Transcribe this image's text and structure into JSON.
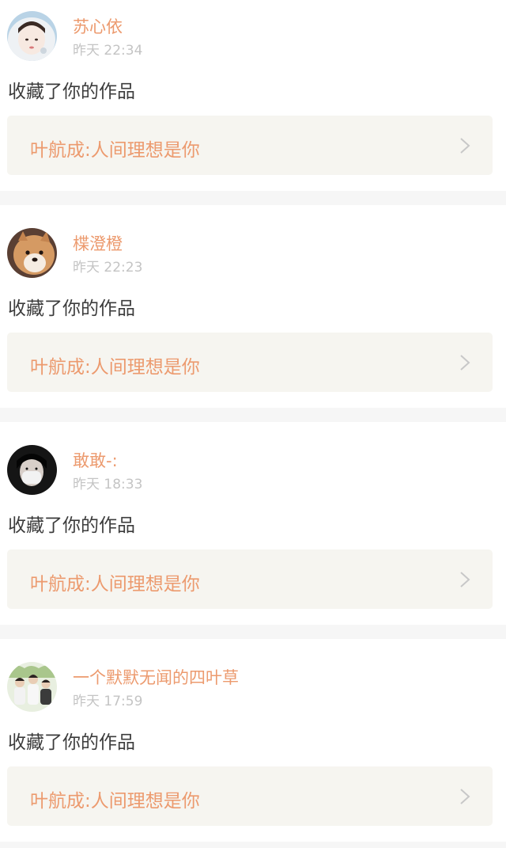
{
  "notifications": [
    {
      "username": "苏心依",
      "time": "昨天 22:34",
      "action": "收藏了你的作品",
      "work_title": "叶航成:人间理想是你",
      "avatar_icon": "avatar-white-hood-girl"
    },
    {
      "username": "楪澄橙",
      "time": "昨天 22:23",
      "action": "收藏了你的作品",
      "work_title": "叶航成:人间理想是你",
      "avatar_icon": "avatar-shiba-dog"
    },
    {
      "username": "敢敢-:",
      "time": "昨天 18:33",
      "action": "收藏了你的作品",
      "work_title": "叶航成:人间理想是你",
      "avatar_icon": "avatar-masked-person"
    },
    {
      "username": "一个默默无闻的四叶草",
      "time": "昨天 17:59",
      "action": "收藏了你的作品",
      "work_title": "叶航成:人间理想是你",
      "avatar_icon": "avatar-group-of-boys"
    }
  ],
  "colors": {
    "accent": "#ec9a6e",
    "timestamp": "#c4c4c4",
    "body_text": "#3c3c3c",
    "link_bg": "#f6f5f0",
    "separator": "#f6f6f6"
  }
}
